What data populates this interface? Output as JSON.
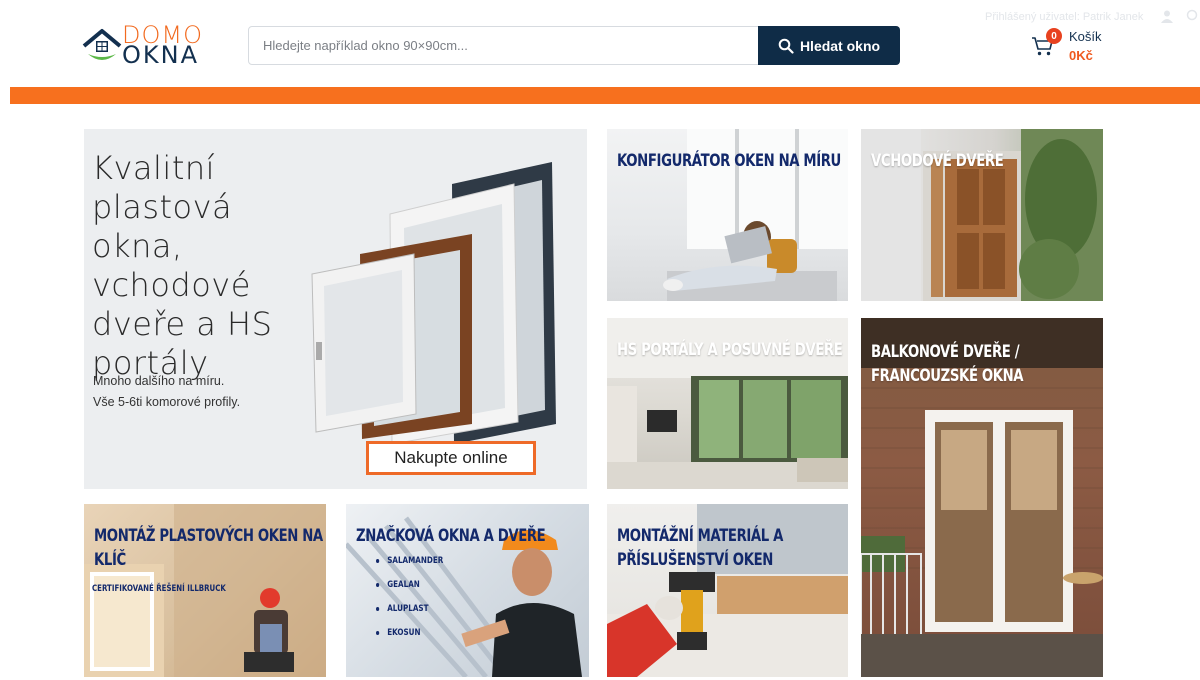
{
  "header": {
    "logo_top": "DOMO",
    "logo_bottom": "OKNA",
    "search_placeholder": "Hledejte například okno 90×90cm...",
    "search_button": "Hledat okno",
    "user_line": "Přihlášený uživatel: Patrik Janek",
    "cart_label": "Košík",
    "cart_count": "0",
    "cart_price": "0Kč"
  },
  "hero": {
    "heading": "Kvalitní plastová okna, vchodové dveře a HS portály",
    "sub1": "Mnoho dalšího na míru.",
    "sub2": "Vše 5-6ti komorové profily.",
    "cta": "Nakupte online"
  },
  "tiles": {
    "konfigurator": "KONFIGURÁTOR OKEN NA MÍRU",
    "vchodove": "VCHODOVÉ DVEŘE",
    "hs_portaly": "HS PORTÁLY A POSUVNÉ DVEŘE",
    "balkonove_1": "BALKONOVÉ DVEŘE /",
    "balkonove_2": "FRANCOUZSKÉ OKNA",
    "montaz_1": "MONTÁŽ PLASTOVÝCH OKEN NA",
    "montaz_2": "KLÍČ",
    "montaz_sub": "CERTIFIKOVANÉ ŘEŠENÍ ILLBRUCK",
    "znackova": "ZNAČKOVÁ OKNA A DVEŘE",
    "brands": [
      "SALAMANDER",
      "GEALAN",
      "ALUPLAST",
      "EKOSUN"
    ],
    "material_1": "MONTÁŽNÍ MATERIÁL A",
    "material_2": "PŘÍSLUŠENSTVÍ OKEN"
  },
  "colors": {
    "brand_navy": "#0f2c47",
    "brand_orange": "#f7701e",
    "title_navy": "#13296b"
  }
}
